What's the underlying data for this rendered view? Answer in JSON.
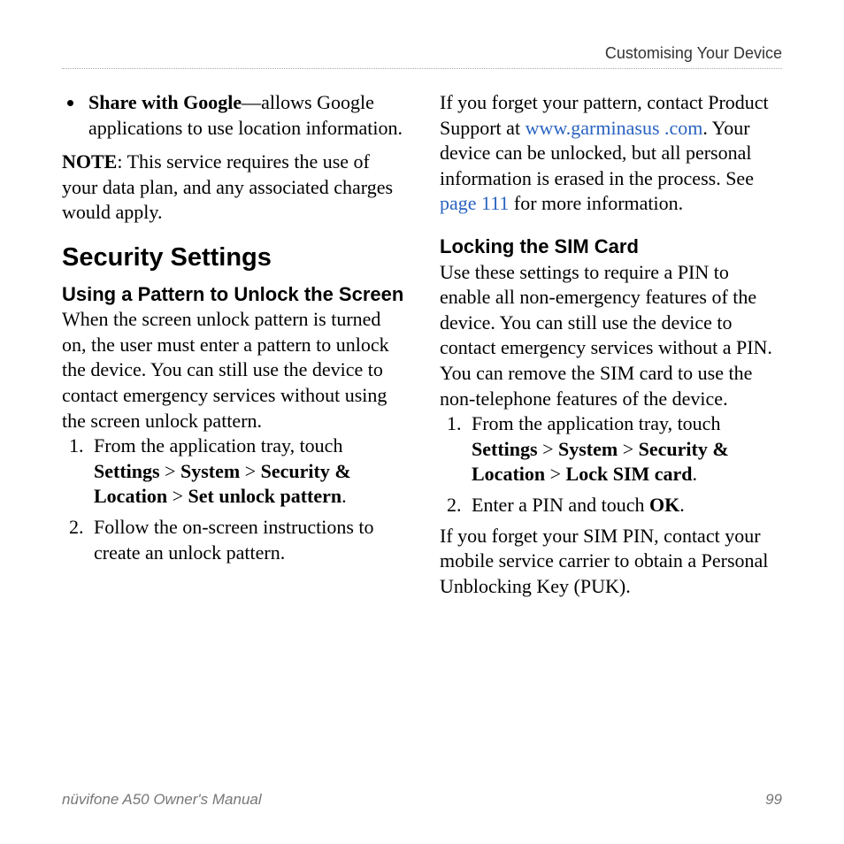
{
  "header": {
    "section": "Customising Your Device"
  },
  "left": {
    "bullet": {
      "label": "Share with Google",
      "rest": "—allows Google applications to use location information."
    },
    "noteLabel": "NOTE",
    "noteRest": ": This service requires the use of your data plan, and any associated charges would apply.",
    "h1": "Security Settings",
    "h2": "Using a Pattern to Unlock the Screen",
    "intro": "When the screen unlock pattern is turned on, the user must enter a pattern to unlock the device. You can still use the device to contact emergency services without using the screen unlock pattern.",
    "step1a": "From the application tray, touch ",
    "nav": {
      "settings": "Settings",
      "system": "System",
      "secloc": "Security & Location",
      "setpattern": "Set unlock pattern"
    },
    "gt": " > ",
    "step2": "Follow the on-screen instructions to create an unlock pattern."
  },
  "right": {
    "para1a": "If you forget your pattern, contact Product Support at ",
    "link1": "www.garminasus .com",
    "para1b": ". Your device can be unlocked, but all personal information is erased in the process. See ",
    "pageLink": "page 111",
    "para1c": " for more information.",
    "h2": "Locking the SIM Card",
    "intro": "Use these settings to require a PIN to enable all non-emergency features of the device. You can still use the device to contact emergency services without a PIN. You can remove the SIM card to use the non-telephone features of the device.",
    "step1a": "From the application tray, touch ",
    "nav": {
      "settings": "Settings",
      "system": "System",
      "secloc": "Security & Location",
      "locksim": "Lock SIM card"
    },
    "gt": " > ",
    "step2a": "Enter a PIN and touch ",
    "ok": "OK",
    "outro": "If you forget your SIM PIN, contact your mobile service carrier to obtain a Personal Unblocking Key (PUK)."
  },
  "footer": {
    "title": "nüvifone A50 Owner's Manual",
    "page": "99"
  }
}
